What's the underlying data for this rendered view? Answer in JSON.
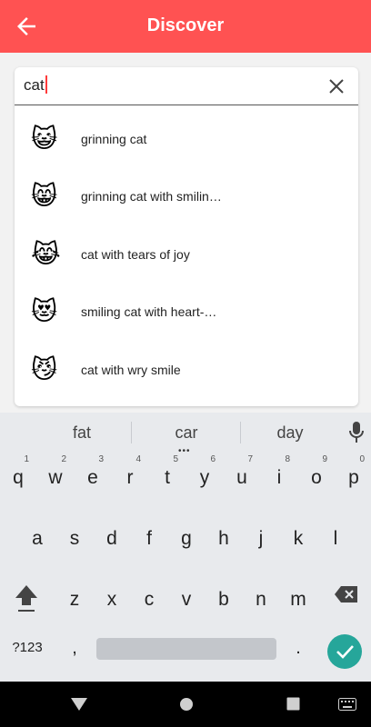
{
  "appbar": {
    "title": "Discover",
    "back_icon": "arrow-back-icon",
    "color": "#ff5252"
  },
  "search": {
    "query": "cat",
    "clear_icon": "close-icon"
  },
  "results": [
    {
      "emoji": "😺",
      "label": "grinning cat"
    },
    {
      "emoji": "😸",
      "label": "grinning cat with smilin…"
    },
    {
      "emoji": "😹",
      "label": "cat with tears of joy"
    },
    {
      "emoji": "😻",
      "label": "smiling cat with heart-…"
    },
    {
      "emoji": "😼",
      "label": "cat with wry smile"
    }
  ],
  "keyboard": {
    "suggestions": [
      "fat",
      "car",
      "day"
    ],
    "row1": [
      {
        "key": "q",
        "num": "1"
      },
      {
        "key": "w",
        "num": "2"
      },
      {
        "key": "e",
        "num": "3"
      },
      {
        "key": "r",
        "num": "4"
      },
      {
        "key": "t",
        "num": "5"
      },
      {
        "key": "y",
        "num": "6"
      },
      {
        "key": "u",
        "num": "7"
      },
      {
        "key": "i",
        "num": "8"
      },
      {
        "key": "o",
        "num": "9"
      },
      {
        "key": "p",
        "num": "0"
      }
    ],
    "row2": [
      "a",
      "s",
      "d",
      "f",
      "g",
      "h",
      "j",
      "k",
      "l"
    ],
    "row3": [
      "z",
      "x",
      "c",
      "v",
      "b",
      "n",
      "m"
    ],
    "symbols_key": "?123",
    "comma_key": ",",
    "period_key": ".",
    "accent_color": "#26a69a"
  },
  "navbar": {
    "icons": [
      "back-triangle-icon",
      "home-circle-icon",
      "recents-square-icon",
      "keyboard-icon"
    ]
  }
}
